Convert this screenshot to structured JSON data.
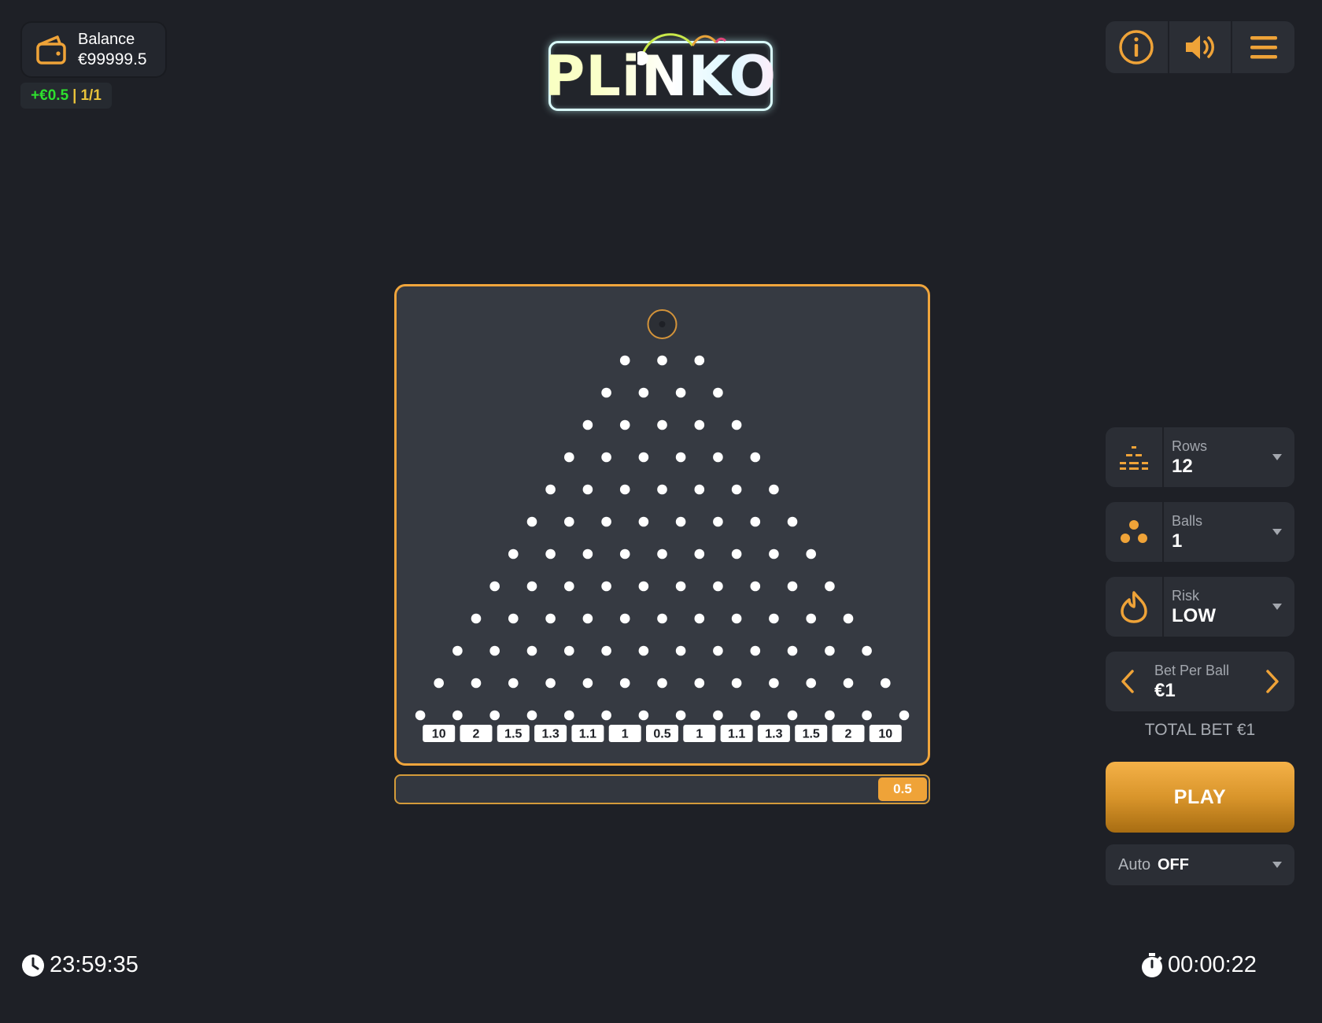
{
  "balance": {
    "label": "Balance",
    "amount": "€99999.5"
  },
  "session": {
    "gain": "+€0.5",
    "separator": "|",
    "count": "1/1"
  },
  "logo": {
    "text": "PLiNKO"
  },
  "top_controls": [
    {
      "name": "info-button",
      "icon": "info-icon"
    },
    {
      "name": "sound-button",
      "icon": "speaker-icon"
    },
    {
      "name": "menu-button",
      "icon": "hamburger-menu-icon"
    }
  ],
  "board": {
    "rows": 12,
    "multipliers": [
      "10",
      "2",
      "1.5",
      "1.3",
      "1.1",
      "1",
      "0.5",
      "1",
      "1.1",
      "1.3",
      "1.5",
      "2",
      "10"
    ],
    "last_result": "0.5"
  },
  "controls": {
    "rows": {
      "label": "Rows",
      "value": "12",
      "icon": "rows-icon"
    },
    "balls": {
      "label": "Balls",
      "value": "1",
      "icon": "balls-icon"
    },
    "risk": {
      "label": "Risk",
      "value": "LOW",
      "icon": "risk-icon"
    },
    "bet_per_ball": {
      "label": "Bet Per Ball",
      "value": "€1"
    },
    "total_bet": "TOTAL BET €1",
    "play": "PLAY",
    "auto": {
      "label": "Auto",
      "value": "OFF"
    }
  },
  "clock": {
    "time": "23:59:35"
  },
  "timer": {
    "elapsed": "00:00:22"
  },
  "colors": {
    "background": "#1e2026",
    "board": "#363a42",
    "accent": "#f0a53c",
    "gain": "#2ee02e",
    "count": "#e8c23a"
  }
}
